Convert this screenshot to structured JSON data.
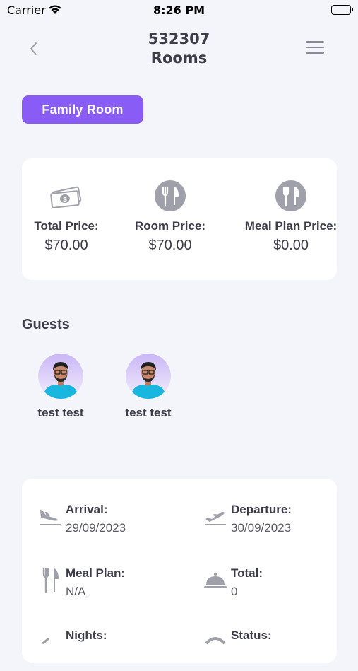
{
  "status_bar": {
    "carrier": "Carrier",
    "time": "8:26 PM"
  },
  "header": {
    "title_line1": "532307",
    "title_line2": "Rooms"
  },
  "room_type": "Family Room",
  "prices": [
    {
      "icon": "money-icon",
      "label": "Total Price:",
      "value": "$70.00"
    },
    {
      "icon": "fork-knife-icon",
      "label": "Room Price:",
      "value": "$70.00"
    },
    {
      "icon": "fork-knife-icon",
      "label": "Meal Plan Price:",
      "value": "$0.00"
    }
  ],
  "guests": {
    "title": "Guests",
    "items": [
      {
        "name": "test test"
      },
      {
        "name": "test test"
      }
    ]
  },
  "details": {
    "arrival": {
      "label": "Arrival:",
      "value": "29/09/2023",
      "icon": "plane-landing-icon"
    },
    "departure": {
      "label": "Departure:",
      "value": "30/09/2023",
      "icon": "plane-takeoff-icon"
    },
    "meal_plan": {
      "label": "Meal Plan:",
      "value": "N/A",
      "icon": "cutlery-icon"
    },
    "total": {
      "label": "Total:",
      "value": "0",
      "icon": "cloche-icon"
    },
    "nights": {
      "label": "Nights:",
      "icon": "plane-icon"
    },
    "status": {
      "label": "Status:",
      "icon": "status-icon"
    }
  },
  "colors": {
    "accent": "#8a5cf6",
    "background": "#f4f5fa",
    "icon_gray": "#a0a0ab"
  }
}
